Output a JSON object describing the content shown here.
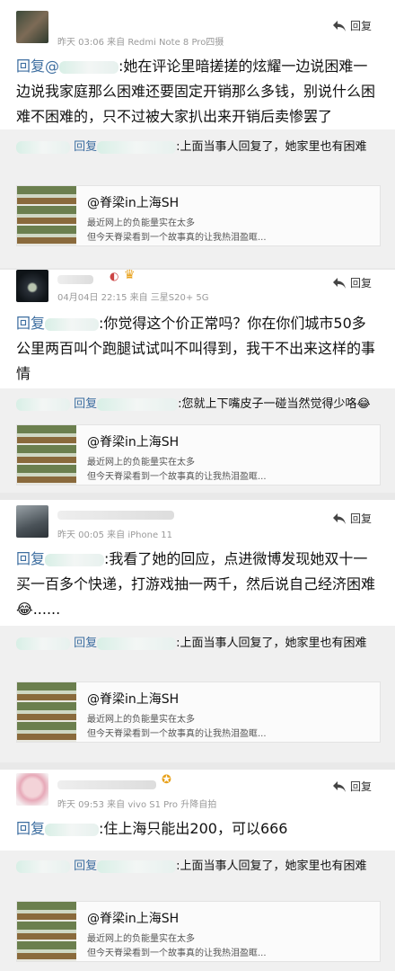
{
  "reply_label": "回复",
  "comments": [
    {
      "meta": "昨天 03:06 来自 Redmi Note 8 Pro四摄",
      "prefix": "回复@",
      "text": ":她在评论里暗搓搓的炫耀一边说困难一边说我家庭那么困难还要固定开销那么多钱，别说什么困难不困难的，只不过被大家扒出来开销后卖惨罢了",
      "quote_prefix": "回复",
      "quote_text": ":上面当事人回复了，她家里也有困难"
    },
    {
      "meta": "04月04日 22:15 来自 三星S20+ 5G",
      "prefix": "回复",
      "text": ":你觉得这个价正常吗？你在你们城市50多公里两百叫个跑腿试试叫不叫得到，我干不出来这样的事情",
      "quote_prefix": "回复",
      "quote_text": ":您就上下嘴皮子一碰当然觉得少咯"
    },
    {
      "meta": "昨天 00:05 来自 iPhone 11",
      "prefix": "回复",
      "text": ":我看了她的回应，点进微博发现她双十一买一百多个快递，打游戏抽一两千，然后说自己经济困难",
      "text_tail": "......",
      "quote_prefix": "回复",
      "quote_text": ":上面当事人回复了，她家里也有困难"
    },
    {
      "meta": "昨天 09:53 来自 vivo S1 Pro 升降自拍",
      "prefix": "回复",
      "text": ":住上海只能出200，可以666",
      "quote_prefix": "回复",
      "quote_text": ":上面当事人回复了，她家里也有困难"
    }
  ],
  "embed": {
    "title": "@脊梁in上海SH",
    "line1": "最近网上的负能量实在太多",
    "line2": "但今天脊梁看到一个故事真的让我热泪盈眶..."
  },
  "colors": {
    "link": "#3d6ea0",
    "quote_bg": "#f0f0f0",
    "card_bg": "#ffffff",
    "page_bg": "#e9e9e9"
  }
}
